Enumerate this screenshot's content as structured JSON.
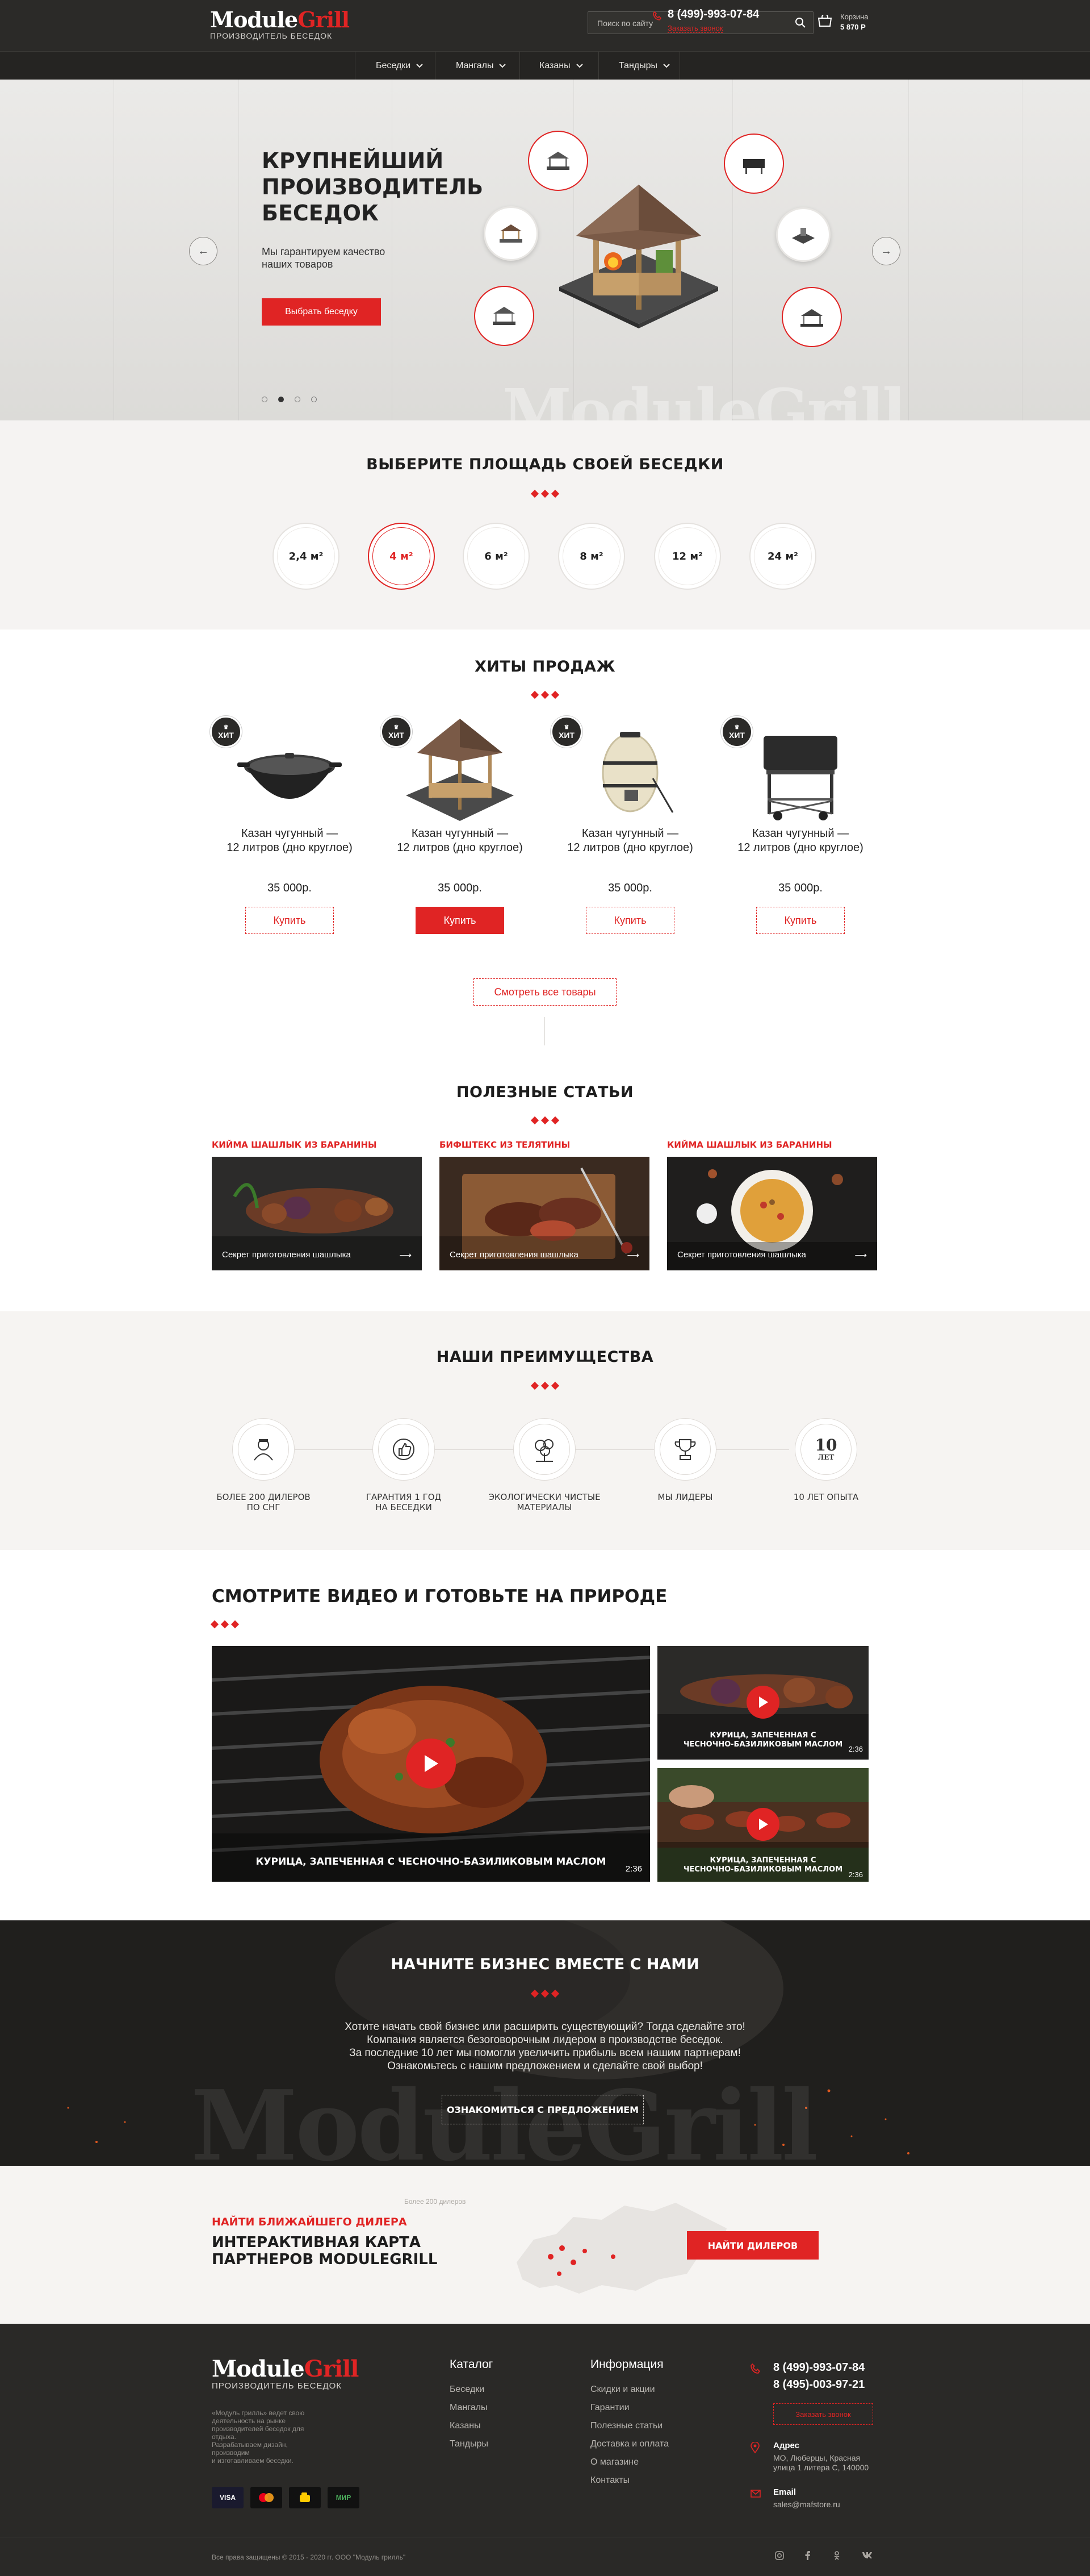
{
  "header": {
    "logo_main": "Module",
    "logo_accent": "Grill",
    "logo_sub": "ПРОИЗВОДИТЕЛЬ БЕСЕДОК",
    "search_placeholder": "Поиск по сайту",
    "phone": "8 (499)-993-07-84",
    "callback": "Заказать звонок",
    "cart_label": "Корзина",
    "cart_total": "5 870 Р"
  },
  "nav": [
    "Беседки",
    "Мангалы",
    "Казаны",
    "Тандыры"
  ],
  "hero": {
    "title_lines": [
      "КРУПНЕЙШИЙ",
      "ПРОИЗВОДИТЕЛЬ",
      "БЕСЕДОК"
    ],
    "subtitle": "Мы гарантируем качество наших товаров",
    "button": "Выбрать беседку",
    "watermark": "ModuleGrill",
    "slides_total": 4,
    "slide_active": 2
  },
  "area": {
    "title": "ВЫБЕРИТЕ ПЛОЩАДЬ СВОЕЙ БЕСЕДКИ",
    "options": [
      "2,4 м²",
      "4 м²",
      "6 м²",
      "8 м²",
      "12 м²",
      "24 м²"
    ],
    "selected": "4 м²"
  },
  "hits": {
    "title": "ХИТЫ ПРОДАЖ",
    "badge": "ХИТ",
    "products": [
      {
        "name_1": "Казан чугунный —",
        "name_2": "12 литров (дно круглое)",
        "price": "35 000р.",
        "button": "Купить"
      },
      {
        "name_1": "Казан чугунный —",
        "name_2": "12 литров (дно круглое)",
        "price": "35 000р.",
        "button": "Купить"
      },
      {
        "name_1": "Казан чугунный —",
        "name_2": "12 литров (дно круглое)",
        "price": "35 000р.",
        "button": "Купить"
      },
      {
        "name_1": "Казан чугунный —",
        "name_2": "12 литров (дно круглое)",
        "price": "35 000р.",
        "button": "Купить"
      }
    ],
    "all_button": "Смотреть все товары"
  },
  "articles": {
    "title": "ПОЛЕЗНЫЕ СТАТЬИ",
    "items": [
      {
        "category": "КИЙМА ШАШЛЫК ИЗ БАРАНИНЫ",
        "caption": "Секрет приготовления шашлыка"
      },
      {
        "category": "БИФШТЕКС ИЗ ТЕЛЯТИНЫ",
        "caption": "Секрет приготовления шашлыка"
      },
      {
        "category": "КИЙМА ШАШЛЫК ИЗ БАРАНИНЫ",
        "caption": "Секрет приготовления шашлыка"
      }
    ]
  },
  "advantages": {
    "title": "НАШИ ПРЕИМУЩЕСТВА",
    "items": [
      {
        "l1": "БОЛЕЕ 200 ДИЛЕРОВ",
        "l2": "ПО СНГ",
        "icon": "dealer-icon"
      },
      {
        "l1": "ГАРАНТИЯ 1 ГОД",
        "l2": "НА БЕСЕДКИ",
        "icon": "thumbs-up-icon"
      },
      {
        "l1": "ЭКОЛОГИЧЕСКИ ЧИСТЫЕ",
        "l2": "МАТЕРИАЛЫ",
        "icon": "tree-icon"
      },
      {
        "l1": "МЫ ЛИДЕРЫ",
        "l2": "",
        "icon": "trophy-icon"
      },
      {
        "l1": "10 ЛЕТ ОПЫТА",
        "l2": "",
        "icon": "ten-years-icon"
      }
    ],
    "years_badge_num": "10",
    "years_badge_txt": "ЛЕТ"
  },
  "videos": {
    "title": "СМОТРИТЕ ВИДЕО И ГОТОВЬТЕ НА ПРИРОДЕ",
    "main": {
      "caption": "КУРИЦА, ЗАПЕЧЕННАЯ С ЧЕСНОЧНО-БАЗИЛИКОВЫМ МАСЛОМ",
      "duration": "2:36"
    },
    "side": [
      {
        "caption_1": "КУРИЦА, ЗАПЕЧЕННАЯ С",
        "caption_2": "ЧЕСНОЧНО-БАЗИЛИКОВЫМ МАСЛОМ",
        "duration": "2:36"
      },
      {
        "caption_1": "КУРИЦА, ЗАПЕЧЕННАЯ С",
        "caption_2": "ЧЕСНОЧНО-БАЗИЛИКОВЫМ МАСЛОМ",
        "duration": "2:36"
      }
    ]
  },
  "business": {
    "title": "НАЧНИТЕ БИЗНЕС ВМЕСТЕ С НАМИ",
    "lines": [
      "Хотите начать свой бизнес или расширить существующий? Тогда сделайте это!",
      "Компания является безоговорочным лидером в производстве беседок.",
      "За последние 10 лет мы помогли увеличить прибыль всем нашим партнерам!",
      "Ознакомьтесь с нашим предложением и сделайте свой выбор!"
    ],
    "button": "ОЗНАКОМИТЬСЯ С ПРЕДЛОЖЕНИЕМ",
    "watermark": "ModuleGrill"
  },
  "dealer": {
    "kicker": "НАЙТИ БЛИЖАЙШЕГО ДИЛЕРА",
    "title_1": "ИНТЕРАКТИВНАЯ КАРТА",
    "title_2": "ПАРТНЕРОВ MODULEGRILL",
    "map_note": "Более 200 дилеров",
    "button": "НАЙТИ ДИЛЕРОВ"
  },
  "footer": {
    "logo_main": "Module",
    "logo_accent": "Grill",
    "logo_sub": "ПРОИЗВОДИТЕЛЬ БЕСЕДОК",
    "about": [
      "«Модуль грилль» ведет свою",
      "деятельность на рынке",
      "производителей беседок для отдыха.",
      "Разрабатываем дизайн, производим",
      "и изготавливаем беседки."
    ],
    "catalog_title": "Каталог",
    "catalog": [
      "Беседки",
      "Мангалы",
      "Казаны",
      "Тандыры"
    ],
    "info_title": "Информация",
    "info": [
      "Скидки и акции",
      "Гарантии",
      "Полезные статьи",
      "Доставка и оплата",
      "О магазине",
      "Контакты"
    ],
    "phone_1": "8 (499)-993-07-84",
    "phone_2": "8 (495)-003-97-21",
    "callback": "Заказать звонок",
    "address_label": "Адрес",
    "address": [
      "МО, Люберцы, Красная",
      "улица 1 литера С, 140000"
    ],
    "email_label": "Email",
    "email": "sales@mafstore.ru",
    "payments": [
      "VISA",
      "MasterCard",
      "Yandex",
      "МИР"
    ],
    "copyright": "Все права защищены © 2015 - 2020 гг. ООО \"Модуль грилль\"",
    "social": [
      "instagram-icon",
      "facebook-icon",
      "odnoklassniki-icon",
      "vk-icon"
    ]
  },
  "colors": {
    "accent": "#e02424",
    "dark": "#2b2a28",
    "light_bg": "#f6f4f2"
  }
}
